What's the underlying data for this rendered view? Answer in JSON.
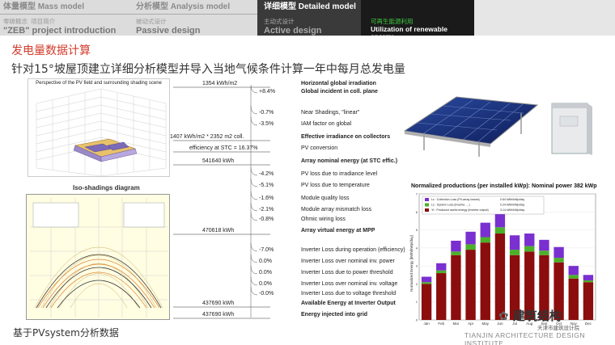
{
  "nav": {
    "tabs": [
      {
        "title": "体量模型 Mass model",
        "sub_cn": "零碳概念",
        "sub_tag": "项目简介",
        "sub_en": "\"ZEB\"  project introduction"
      },
      {
        "title": "分析模型 Analysis model",
        "sub_cn": "被动式设计",
        "sub_en": "Passive design"
      },
      {
        "title": "详细模型 Detailed model",
        "sub_cn": "主动式设计",
        "sub_en": "Active design"
      },
      {
        "title": "",
        "sub_cn": "可再生能源利用",
        "sub_en": "Utilization of renewable energy"
      }
    ]
  },
  "section_title": "发电量数据计算",
  "headline": "针对15°坡屋顶建立详细分析模型并导入当地气候条件计算一年中每月总发电量",
  "pv_scene": {
    "title": "Perspective of the PV field and surrounding shading scene"
  },
  "iso": {
    "title": "Iso-shadings diagram"
  },
  "footer_left": "基于PVsystem分析数据",
  "loss_diagram": {
    "rows": [
      {
        "value": "1354 kWh/m2",
        "label": "Horizontal global irradiation",
        "bold": true
      },
      {
        "pct": "+8.4%",
        "label": "Global incident in coll. plane",
        "bold": true
      },
      {
        "pct": "-0.7%",
        "label": "Near Shadings, \"linear\"",
        "bold": false
      },
      {
        "pct": "-3.5%",
        "label": "IAM factor on global",
        "bold": false
      },
      {
        "value": "1407 kWh/m2 * 2352 m2 coll.",
        "label": "Effective irradiance on collectors",
        "bold": true
      },
      {
        "value": "efficiency at STC = 16.37%",
        "label": "PV conversion",
        "bold": false
      },
      {
        "value": "541640 kWh",
        "label": "Array nominal energy (at STC effic.)",
        "bold": true
      },
      {
        "pct": "-4.2%",
        "label": "PV loss due to irradiance level",
        "bold": false
      },
      {
        "pct": "-5.1%",
        "label": "PV loss due to temperature",
        "bold": false
      },
      {
        "pct": "-1.6%",
        "label": "Module quality loss",
        "bold": false
      },
      {
        "pct": "-2.1%",
        "label": "Module array mismatch loss",
        "bold": false
      },
      {
        "pct": "-0.8%",
        "label": "Ohmic wiring loss",
        "bold": false
      },
      {
        "value": "470618 kWh",
        "label": "Array virtual energy at MPP",
        "bold": true
      },
      {
        "pct": "-7.0%",
        "label": "Inverter Loss during operation (efficiency)",
        "bold": false
      },
      {
        "pct": "0.0%",
        "label": "Inverter Loss over nominal inv. power",
        "bold": false
      },
      {
        "pct": "0.0%",
        "label": "Inverter Loss due to power threshold",
        "bold": false
      },
      {
        "pct": "0.0%",
        "label": "Inverter Loss over nominal inv. voltage",
        "bold": false
      },
      {
        "pct": "-0.0%",
        "label": "Inverter Loss due to voltage threshold",
        "bold": false
      },
      {
        "value": "437690 kWh",
        "label": "Available Energy at Inverter Output",
        "bold": true
      },
      {
        "value": "437690 kWh",
        "label": "Energy injected into grid",
        "bold": true
      }
    ]
  },
  "chart_data": {
    "type": "bar",
    "title": "Normalized productions (per installed kWp):  Nominal power 382 kWp",
    "ylabel": "Normalized Energy [kWh/kWp/day]",
    "categories": [
      "Jan",
      "Feb",
      "Mar",
      "Apr",
      "May",
      "Jun",
      "Jul",
      "Aug",
      "Sep",
      "Oct",
      "Nov",
      "Dec"
    ],
    "ylim": [
      0,
      7
    ],
    "series": [
      {
        "name": "Lc : Collection Loss (PV-array losses)",
        "legend_value": "0.64 kWh/kWp/day",
        "color": "#7a2fd0",
        "values": [
          0.3,
          0.4,
          0.6,
          0.7,
          0.8,
          0.9,
          0.8,
          0.7,
          0.6,
          0.6,
          0.5,
          0.3
        ]
      },
      {
        "name": "Ls : System Loss (inverter, ...)",
        "legend_value": "0.24 kWh/kWp/day",
        "color": "#4caf2a",
        "values": [
          0.1,
          0.15,
          0.2,
          0.3,
          0.3,
          0.35,
          0.3,
          0.3,
          0.25,
          0.25,
          0.2,
          0.1
        ]
      },
      {
        "name": "Yf : Produced useful energy  (inverter output)",
        "legend_value": "3.14 kWh/kWp/day",
        "color": "#8b0d0d",
        "values": [
          2.0,
          2.6,
          3.6,
          3.9,
          4.3,
          4.8,
          3.6,
          3.8,
          3.6,
          3.2,
          2.3,
          2.1
        ]
      }
    ]
  },
  "watermark": {
    "logo": "建筑结构",
    "sub": "天津市建筑设计院",
    "en": "TIANJIN ARCHITECTURE DESIGN INSTITUTE"
  },
  "colors": {
    "accent_red": "#d23b2a",
    "nav_active": "#3a3a3a",
    "nav_bg": "#dcdcdc",
    "green_label": "#3ec63e"
  }
}
